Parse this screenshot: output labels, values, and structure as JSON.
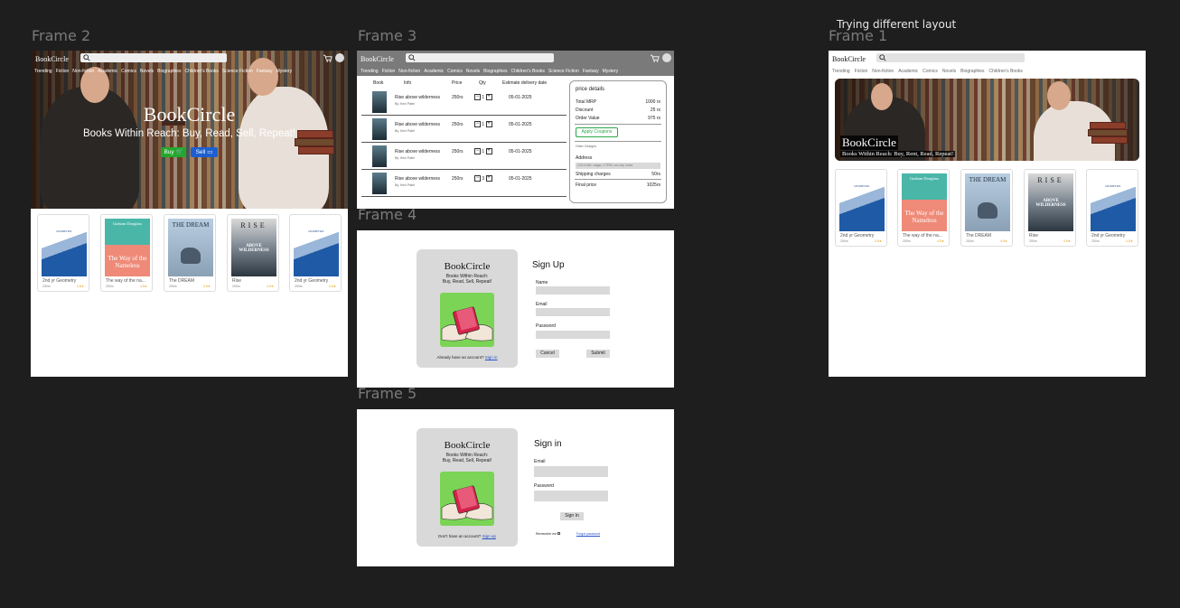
{
  "canvas": {
    "labels": {
      "f2": "Frame 2",
      "f3": "Frame 3",
      "f4": "Frame 4",
      "f5": "Frame 5",
      "f1": "Frame 1"
    },
    "note": "Trying different layout"
  },
  "brand": "BookCircle",
  "categories": [
    "Trending",
    "Fiction",
    "Non-fiction",
    "Academic",
    "Comics",
    "Novels",
    "Biographies",
    "Children's Books",
    "Science Fiction",
    "Fantasy",
    "Mystery"
  ],
  "categories_f1": [
    "Trending",
    "Fiction",
    "Non-fiction",
    "Academic",
    "Comics",
    "Novels",
    "Biographies",
    "Children's Books"
  ],
  "hero": {
    "title": "BookCircle",
    "tagline": "Books Within Reach: Buy, Read, Sell, Repeat!",
    "buy": "Buy",
    "sell": "Sell",
    "tagline_f1": "Books Within Reach: Buy, Rent, Read, Repeat!"
  },
  "books": [
    {
      "title": "2nd yr Geometry",
      "price": "250rs",
      "rating": "4.5★",
      "cover": "GEOMETRIC"
    },
    {
      "title": "The way of the na...",
      "price": "250rs",
      "rating": "4.5★",
      "cover_author": "Graham Douglass",
      "cover_title": "The Way of the Nameless"
    },
    {
      "title": "The DREAM",
      "price": "250rs",
      "rating": "4.5★",
      "cover": "THE DREAM"
    },
    {
      "title": "Rise",
      "price": "250rs",
      "rating": "4.5★",
      "cover": "RISE",
      "cover_sub": "ABOVE WILDERNESS"
    },
    {
      "title": "2nd yr Geometry",
      "price": "250rs",
      "rating": "4.5★",
      "cover": "GEOMETRIC"
    }
  ],
  "books_f1_last": "2nd yr Geometry",
  "cart": {
    "headers": [
      "Book",
      "Info",
      "Price",
      "Qty",
      "Estimate delivery date"
    ],
    "rows": [
      {
        "title": "Rise above wilderness",
        "author": "By: Kevi Patel",
        "price": "250rs",
        "qty": "1",
        "date": "05-01-2025"
      },
      {
        "title": "Rise above wilderness",
        "author": "By: Kevi Patel",
        "price": "250rs",
        "qty": "1",
        "date": "05-01-2025"
      },
      {
        "title": "Rise above wilderness",
        "author": "By: Kevi Patel",
        "price": "250rs",
        "qty": "1",
        "date": "05-01-2025"
      },
      {
        "title": "Rise above wilderness",
        "author": "By: Kevi Patel",
        "price": "250rs",
        "qty": "3",
        "date": "05-01-2025"
      }
    ],
    "price_details": {
      "title": "price details",
      "mrp_label": "Total MRP",
      "mrp": "1000 rs",
      "disc_label": "Discount",
      "disc": "25 rs",
      "order_label": "Order Value",
      "order": "975 rs",
      "coupon": "Apply Coupons",
      "other": "Other Charges",
      "address_label": "Address",
      "address": "12/13 ABC nagar, CTRM, xxx city, india",
      "ship_label": "Shipping charges",
      "ship": "50rs",
      "final_label": "Final price",
      "final": "1025rs"
    }
  },
  "auth": {
    "tagline_l1": "Books Within Reach:",
    "tagline_l2": "Buy, Read, Sell, Repeat!",
    "signup": {
      "title": "Sign Up",
      "name": "Name",
      "email": "Email",
      "password": "Password",
      "cancel": "Cancel",
      "submit": "Submit",
      "footer": "Already have an account?",
      "footer_link": "Sign in"
    },
    "signin": {
      "title": "Sign in",
      "email": "Email",
      "password": "Password",
      "button": "Sign In",
      "remember": "Remember me",
      "forgot": "Forgot password",
      "footer": "Don't have an account?",
      "footer_link": "Sign up"
    }
  }
}
